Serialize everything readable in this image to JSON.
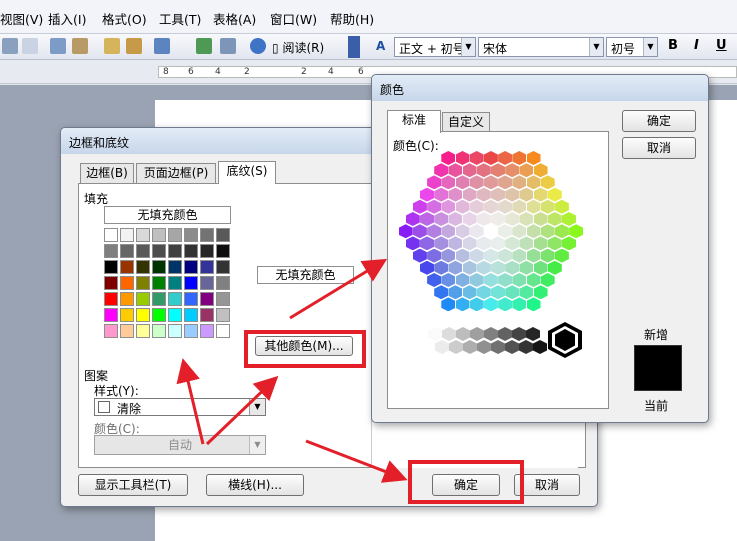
{
  "menu": [
    "视图(V)",
    "插入(I)",
    "格式(O)",
    "工具(T)",
    "表格(A)",
    "窗口(W)",
    "帮助(H)"
  ],
  "toolbar": {
    "read_label": "阅读(R)",
    "style_value": "正文 + 初号",
    "font_value": "宋体",
    "size_value": "初号",
    "bold": "B",
    "italic": "I",
    "underline": "U"
  },
  "ruler": {
    "ticks": [
      "8",
      "6",
      "4",
      "2",
      "2",
      "4",
      "6"
    ]
  },
  "borders_dialog": {
    "title": "边框和底纹",
    "tabs": [
      "边框(B)",
      "页面边框(P)",
      "底纹(S)"
    ],
    "fill_heading": "填充",
    "no_fill_button": "无填充颜色",
    "no_fill_preview": "无填充颜色",
    "more_colors_button": "其他颜色(M)...",
    "pattern_heading": "图案",
    "style_label": "样式(Y):",
    "style_value": "清除",
    "color_label": "颜色(C):",
    "color_value": "自动",
    "show_toolbar_button": "显示工具栏(T)",
    "hline_button": "横线(H)...",
    "ok": "确定",
    "cancel": "取消",
    "palette": [
      [
        "#ffffff",
        "#f2f2f2",
        "#d9d9d9",
        "#bfbfbf",
        "#a6a6a6",
        "#8c8c8c",
        "#737373",
        "#595959"
      ],
      [
        "#7f7f7f",
        "#666666",
        "#595959",
        "#4d4d4d",
        "#404040",
        "#333333",
        "#262626",
        "#0d0d0d"
      ],
      [
        "#000000",
        "#993300",
        "#333300",
        "#003300",
        "#003366",
        "#000080",
        "#333399",
        "#333333"
      ],
      [
        "#800000",
        "#ff6600",
        "#808000",
        "#008000",
        "#008080",
        "#0000ff",
        "#666699",
        "#808080"
      ],
      [
        "#ff0000",
        "#ff9900",
        "#99cc00",
        "#339966",
        "#33cccc",
        "#3366ff",
        "#800080",
        "#969696"
      ],
      [
        "#ff00ff",
        "#ffcc00",
        "#ffff00",
        "#00ff00",
        "#00ffff",
        "#00ccff",
        "#993366",
        "#c0c0c0"
      ],
      [
        "#ff99cc",
        "#ffcc99",
        "#ffff99",
        "#ccffcc",
        "#ccffff",
        "#99ccff",
        "#cc99ff",
        "#ffffff"
      ]
    ]
  },
  "color_dialog": {
    "title": "颜色",
    "tabs": [
      "标准",
      "自定义"
    ],
    "colors_label": "颜色(C):",
    "ok": "确定",
    "cancel": "取消",
    "new_label": "新增",
    "current_label": "当前",
    "new_color": "#000000"
  }
}
